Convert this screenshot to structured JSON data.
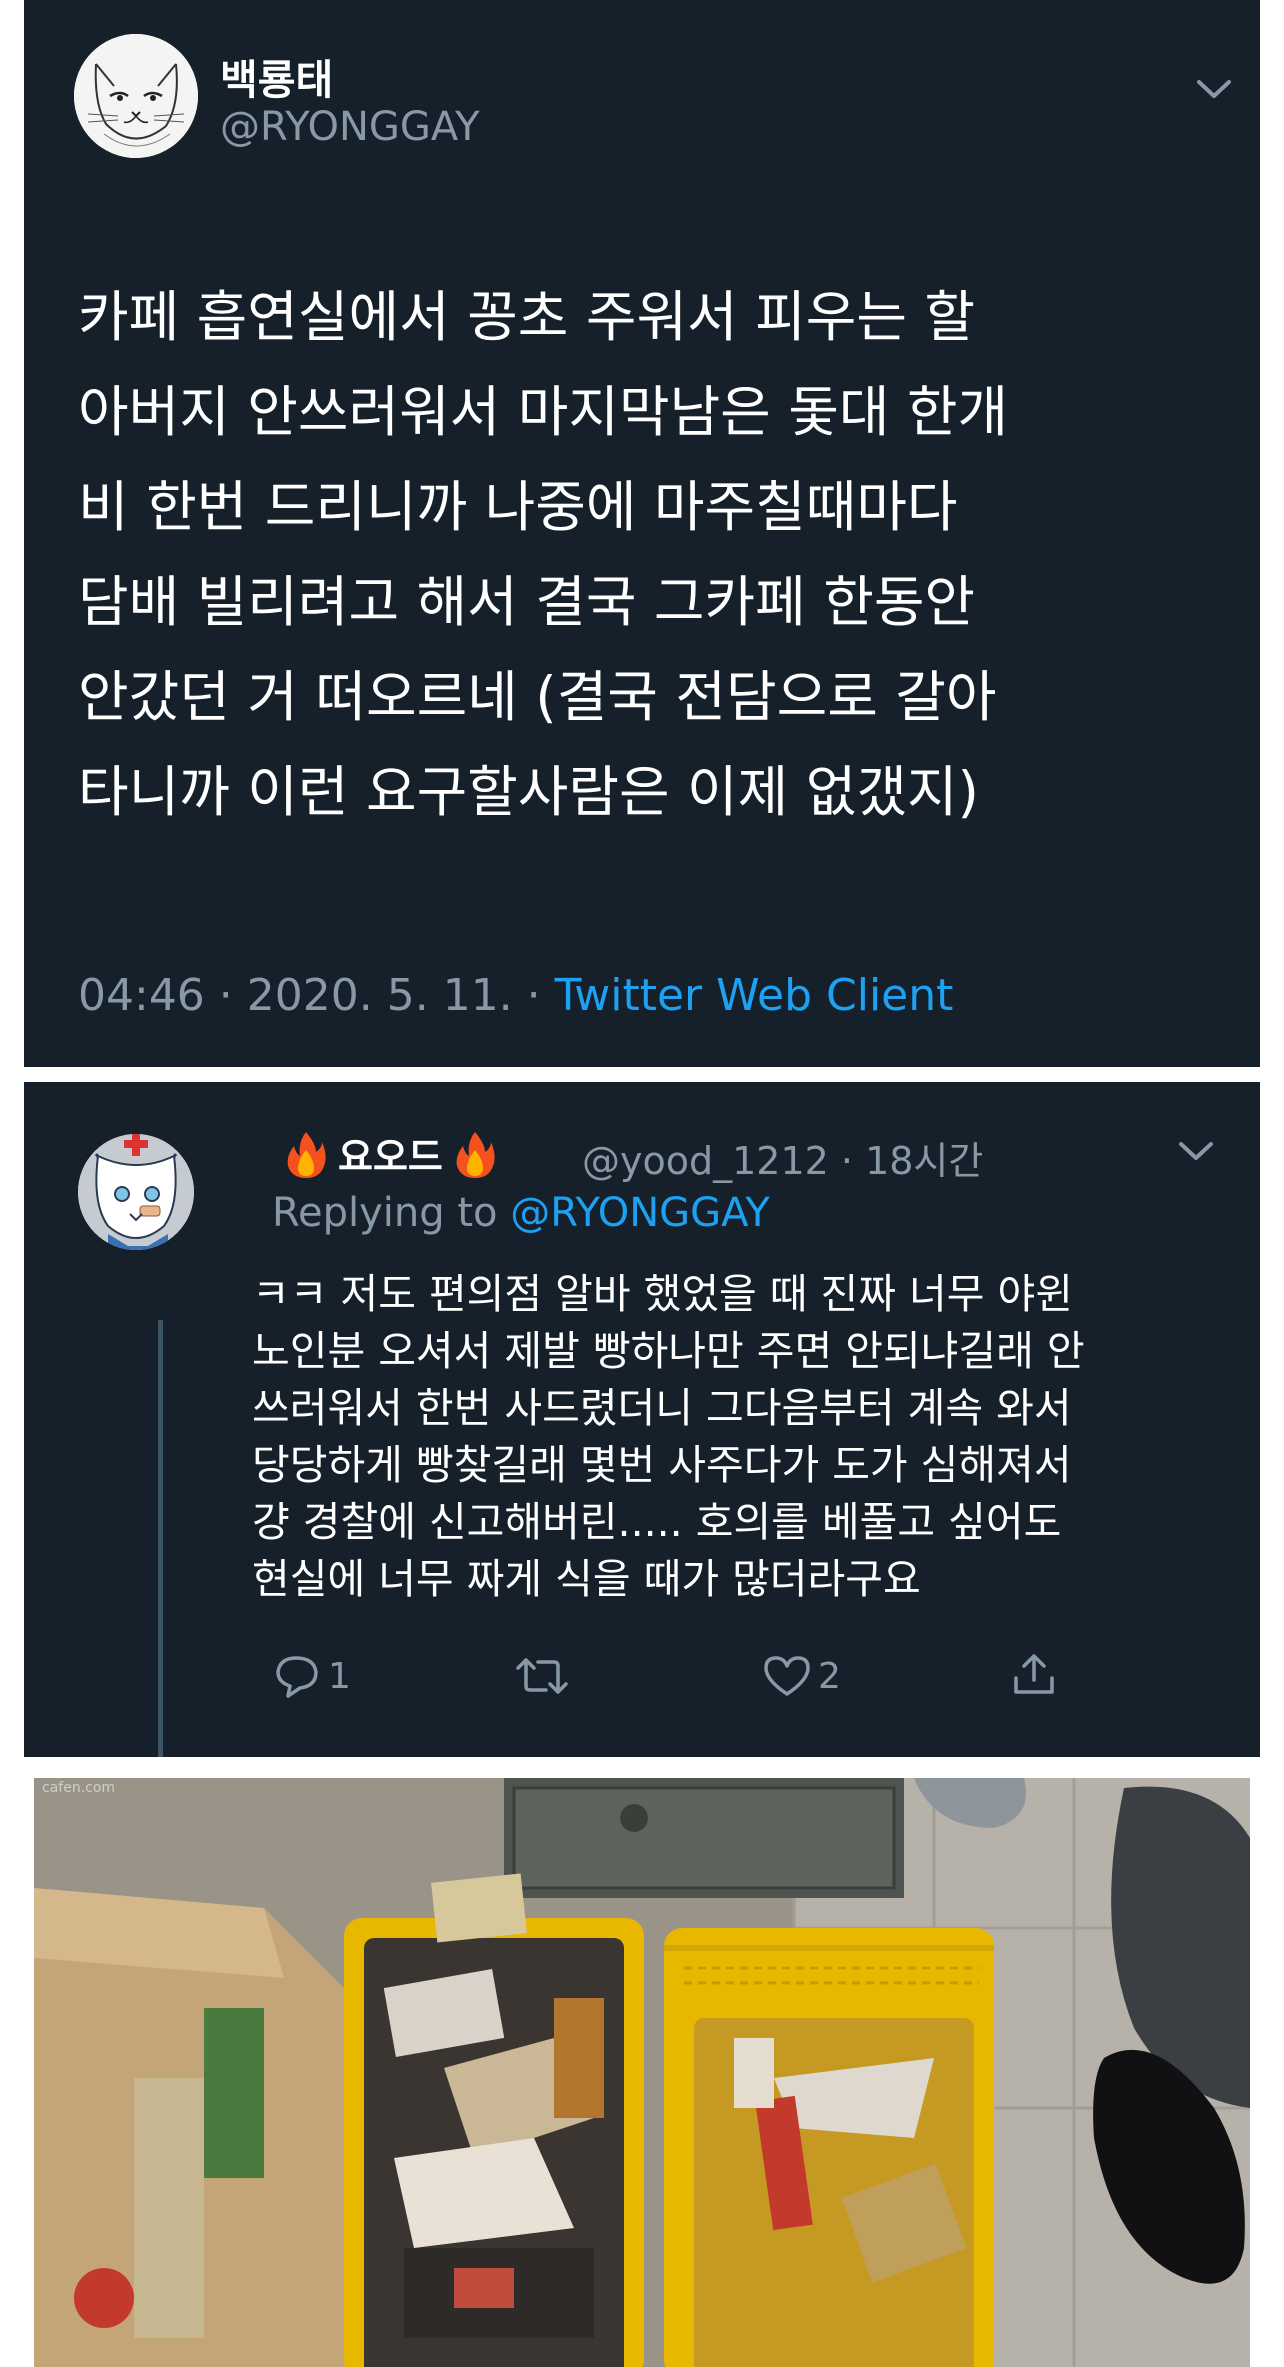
{
  "main_tweet": {
    "display_name": "백룡태",
    "handle": "@RYONGGAY",
    "text_lines": [
      "카페 흡연실에서 꽁초 주워서 피우는 할",
      "아버지 안쓰러워서 마지막남은 돛대 한개",
      "비 한번 드리니까 나중에 마주칠때마다",
      "담배 빌리려고 해서 결국 그카페 한동안",
      "안갔던 거 떠오르네 (결국 전담으로 갈아",
      "타니까 이런 요구할사람은 이제 없갰지)"
    ],
    "time": "04:46",
    "date": "2020. 5. 11.",
    "separator": " · ",
    "client": "Twitter Web Client",
    "menu_icon": "chevron-down-icon",
    "avatar_icon": "cat-sketch-avatar"
  },
  "reply_tweet": {
    "display_name": "요오드",
    "name_emoji": "fire-icon",
    "handle": "@yood_1212",
    "separator": " · ",
    "time_ago": "18시간",
    "replying_prefix": "Replying to ",
    "replying_to": "@RYONGGAY",
    "text_lines": [
      "ㅋㅋ 저도 편의점 알바 했었을 때 진짜 너무 야윈",
      "노인분 오셔서 제발 빵하나만 주면 안되냐길래 안",
      "쓰러워서 한번 사드렸더니 그다음부터 계속 와서",
      "당당하게 빵찾길래 몇번 사주다가 도가 심해져서",
      "걍 경찰에 신고해버린..... 호의를 베풀고 싶어도",
      "현실에 너무 짜게 식을 때가 많더라구요"
    ],
    "actions": {
      "reply_count": "1",
      "retweet_count": "",
      "like_count": "2"
    },
    "menu_icon": "chevron-down-icon",
    "avatar_icon": "white-wolf-avatar"
  },
  "photo": {
    "watermark": "cafen.com",
    "description_icon": "convenience-store-baskets-photo"
  },
  "colors": {
    "card_bg": "#15202b",
    "text": "#ffffff",
    "secondary": "#8899a6",
    "accent": "#1da1f2",
    "basket": "#f2c400"
  }
}
